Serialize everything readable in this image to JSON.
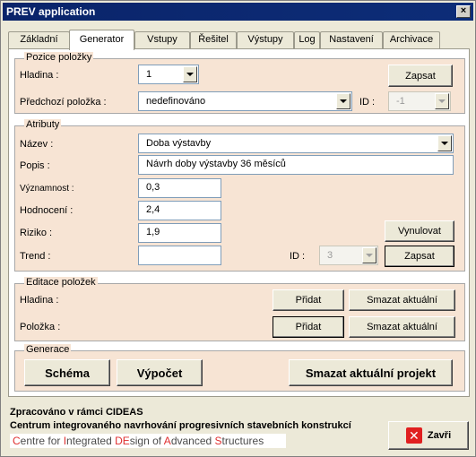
{
  "window": {
    "title": "PREV application",
    "close_glyph": "×"
  },
  "tabs": [
    {
      "label": "Základní"
    },
    {
      "label": "Generator"
    },
    {
      "label": "Vstupy"
    },
    {
      "label": "Řešitel"
    },
    {
      "label": "Výstupy"
    },
    {
      "label": "Log"
    },
    {
      "label": "Nastavení"
    },
    {
      "label": "Archivace"
    }
  ],
  "active_tab": "Generator",
  "pozice": {
    "caption": "Pozice položky",
    "hladina_label": "Hladina :",
    "hladina_value": "1",
    "zapsat_label": "Zapsat",
    "predchozi_label": "Předchozí položka :",
    "predchozi_value": "nedefinováno",
    "id_label": "ID :",
    "id_value": "-1"
  },
  "atributy": {
    "caption": "Atributy",
    "nazev_label": "Název :",
    "nazev_value": "Doba výstavby",
    "popis_label": "Popis :",
    "popis_value": "Návrh doby výstavby 36 měsíců",
    "vyznamnost_label": "Významnost :",
    "vyznamnost_value": "0,3",
    "hodnoceni_label": "Hodnocení :",
    "hodnoceni_value": "2,4",
    "riziko_label": "Riziko :",
    "riziko_value": "1,9",
    "trend_label": "Trend :",
    "trend_value": "",
    "id_label": "ID :",
    "id_value": "3",
    "vynulovat_label": "Vynulovat",
    "zapsat_label": "Zapsat"
  },
  "editace": {
    "caption": "Editace položek",
    "hladina_label": "Hladina :",
    "polozka_label": "Položka :",
    "pridat_label": "Přidat",
    "smazat_label": "Smazat aktuální"
  },
  "generace": {
    "caption": "Generace",
    "schema_label": "Schéma",
    "vypocet_label": "Výpočet",
    "smazat_projekt_label": "Smazat aktuální projekt"
  },
  "footer": {
    "line1": "Zpracováno v rámci CIDEAS",
    "line2": "Centrum integrovaného navrhování progresivních stavebních konstrukcí",
    "logo_parts": [
      "C",
      "entre for ",
      "I",
      "ntegrated ",
      "DE",
      "sign of ",
      "A",
      "dvanced ",
      "S",
      "tructures"
    ],
    "close_label": "Zavři"
  },
  "colors": {
    "titlebar": "#0a246a",
    "group_bg": "#f7e4d4",
    "window_bg": "#ece9d8",
    "logo_accent": "#e03030"
  }
}
